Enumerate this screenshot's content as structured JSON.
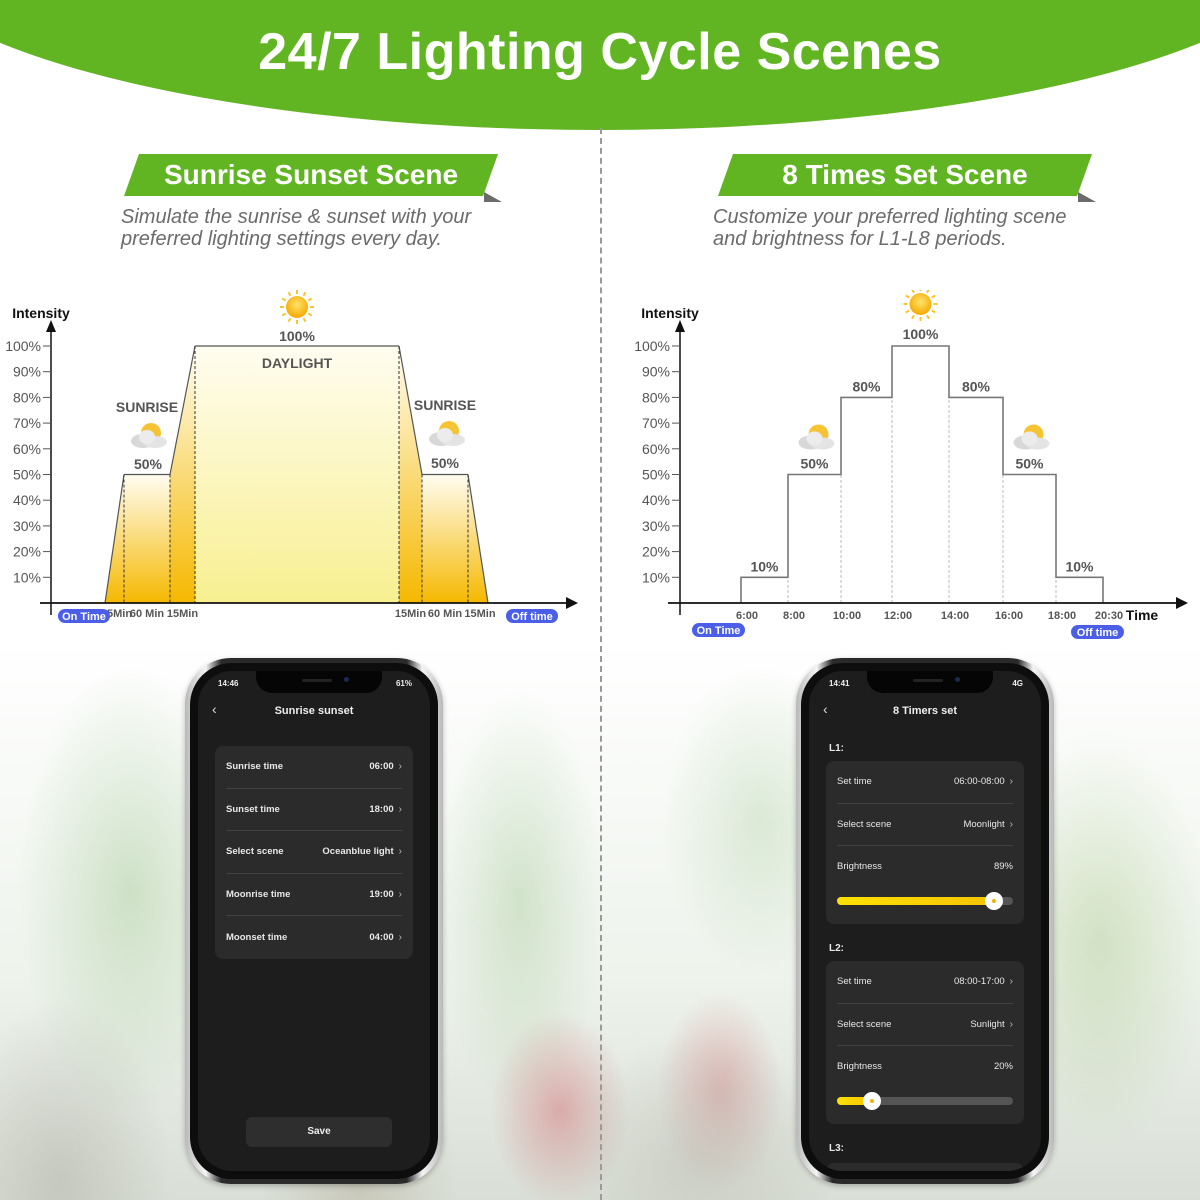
{
  "header": {
    "title": "24/7 Lighting Cycle Scenes"
  },
  "colors": {
    "brand_green": "#62b522",
    "pill_blue": "#4a5ee8",
    "fill_orange": "#f5b800",
    "fill_light": "#fbf4a0",
    "slider_yellow": "#ffd800"
  },
  "left": {
    "ribbon": "Sunrise Sunset Scene",
    "subtitle_line1": "Simulate the sunrise & sunset with your",
    "subtitle_line2": "preferred lighting settings every day."
  },
  "right": {
    "ribbon": "8 Times Set Scene",
    "subtitle_line1": "Customize your preferred lighting scene",
    "subtitle_line2": "and brightness for L1-L8 periods."
  },
  "chart_data": [
    {
      "type": "area",
      "title": "Sunrise Sunset Scene",
      "ylabel": "Intensity",
      "xlabel": "",
      "ylim": [
        0,
        100
      ],
      "yticks": [
        "100%",
        "90%",
        "80%",
        "70%",
        "60%",
        "50%",
        "40%",
        "30%",
        "20%",
        "10%"
      ],
      "ytick_values": [
        100,
        90,
        80,
        70,
        60,
        50,
        40,
        30,
        20,
        10
      ],
      "segments": [
        {
          "label": "15Min",
          "from": 0,
          "to": 50,
          "kind": "ramp"
        },
        {
          "label": "60 Min",
          "from": 50,
          "to": 50,
          "kind": "hold"
        },
        {
          "label": "15Min",
          "from": 50,
          "to": 100,
          "kind": "ramp"
        },
        {
          "label": "",
          "from": 100,
          "to": 100,
          "kind": "daylight"
        },
        {
          "label": "15Min",
          "from": 100,
          "to": 50,
          "kind": "ramp"
        },
        {
          "label": "60 Min",
          "from": 50,
          "to": 50,
          "kind": "hold"
        },
        {
          "label": "15Min",
          "from": 50,
          "to": 0,
          "kind": "ramp"
        }
      ],
      "annotations": [
        {
          "text": "SUNRISE",
          "value": "50%",
          "icon": "sun-cloud-icon"
        },
        {
          "text": "DAYLIGHT",
          "value": "100%",
          "icon": "sun-icon"
        },
        {
          "text": "SUNRISE",
          "value": "50%",
          "icon": "sun-cloud-icon"
        }
      ],
      "start_marker": "On Time",
      "end_marker": "Off time",
      "grid": false
    },
    {
      "type": "line",
      "title": "8 Times Set Scene",
      "ylabel": "Intensity",
      "xlabel": "Time",
      "ylim": [
        0,
        100
      ],
      "yticks": [
        "100%",
        "90%",
        "80%",
        "70%",
        "60%",
        "50%",
        "40%",
        "30%",
        "20%",
        "10%"
      ],
      "ytick_values": [
        100,
        90,
        80,
        70,
        60,
        50,
        40,
        30,
        20,
        10
      ],
      "x": [
        "6:00",
        "8:00",
        "10:00",
        "12:00",
        "14:00",
        "16:00",
        "18:00",
        "20:30"
      ],
      "steps": [
        {
          "start": "6:00",
          "end": "8:00",
          "value": 10,
          "label": "10%"
        },
        {
          "start": "8:00",
          "end": "10:00",
          "value": 50,
          "label": "50%",
          "icon": "sun-cloud-icon"
        },
        {
          "start": "10:00",
          "end": "12:00",
          "value": 80,
          "label": "80%"
        },
        {
          "start": "12:00",
          "end": "14:00",
          "value": 100,
          "label": "100%",
          "icon": "sun-icon"
        },
        {
          "start": "14:00",
          "end": "16:00",
          "value": 80,
          "label": "80%"
        },
        {
          "start": "16:00",
          "end": "18:00",
          "value": 50,
          "label": "50%",
          "icon": "sun-cloud-icon"
        },
        {
          "start": "18:00",
          "end": "20:30",
          "value": 10,
          "label": "10%"
        }
      ],
      "start_marker": "On Time",
      "end_marker": "Off time",
      "grid": false
    }
  ],
  "phone_left": {
    "status_time": "14:46",
    "status_right": "61%",
    "title": "Sunrise sunset",
    "rows": [
      {
        "label": "Sunrise time",
        "value": "06:00"
      },
      {
        "label": "Sunset time",
        "value": "18:00"
      },
      {
        "label": "Select scene",
        "value": "Oceanblue light"
      },
      {
        "label": "Moonrise time",
        "value": "19:00"
      },
      {
        "label": "Moonset time",
        "value": "04:00"
      }
    ],
    "save_label": "Save"
  },
  "phone_right": {
    "status_time": "14:41",
    "status_right": "4G",
    "title": "8 Timers set",
    "sections": [
      {
        "label": "L1:",
        "set_time_label": "Set time",
        "set_time": "06:00-08:00",
        "scene_label": "Select scene",
        "scene": "Moonlight",
        "brightness_label": "Brightness",
        "brightness_text": "89%",
        "brightness": 89
      },
      {
        "label": "L2:",
        "set_time_label": "Set time",
        "set_time": "08:00-17:00",
        "scene_label": "Select scene",
        "scene": "Sunlight",
        "brightness_label": "Brightness",
        "brightness_text": "20%",
        "brightness": 20
      },
      {
        "label": "L3:"
      }
    ]
  },
  "chevron": "›",
  "back_glyph": "‹"
}
